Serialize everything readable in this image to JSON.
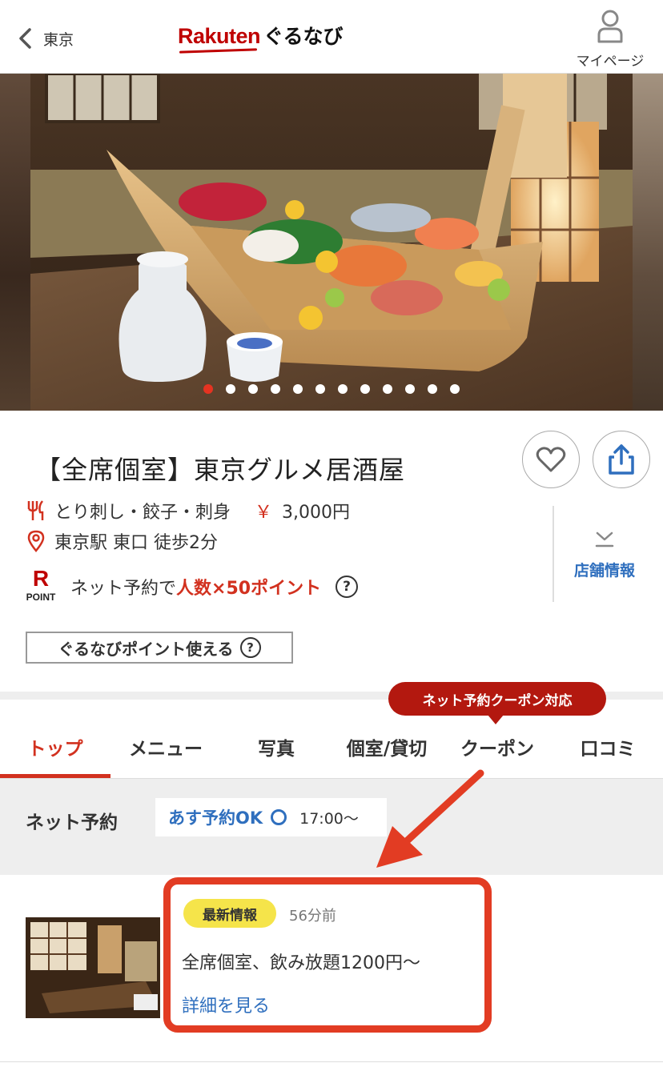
{
  "header": {
    "back_label": "東京",
    "logo_rakuten": "Rakuten",
    "logo_gnavi": "ぐるなび",
    "mypage_label": "マイページ"
  },
  "hero": {
    "slide_count": 12,
    "active_slide": 1
  },
  "shop": {
    "name": "【全席個室】東京グルメ居酒屋",
    "genre": "とり刺し・餃子・刺身",
    "price_mark": "￥",
    "price": "3,000円",
    "access": "東京駅 東口 徒歩2分",
    "store_info_label": "店舗情報",
    "point_r": "R",
    "point_word": "POINT",
    "point_prefix": "ネット予約で",
    "point_highlight": "人数×50ポイント",
    "help_mark": "?",
    "gnavi_point_label": "ぐるなびポイント使える"
  },
  "tabs": {
    "coupon_bubble": "ネット予約クーポン対応",
    "items": [
      {
        "label": "トップ"
      },
      {
        "label": "メニュー"
      },
      {
        "label": "写真"
      },
      {
        "label": "個室/貸切"
      },
      {
        "label": "クーポン"
      },
      {
        "label": "口コミ"
      }
    ],
    "active_index": 0
  },
  "reserve": {
    "label": "ネット予約",
    "ok_label": "あす予約OK",
    "time": "17:00〜"
  },
  "news": {
    "badge": "最新情報",
    "time_ago": "56分前",
    "text": "全席個室、飲み放題1200円〜",
    "link": "詳細を見る"
  },
  "colors": {
    "accent_red": "#d2311f",
    "link_blue": "#2f6fbe",
    "badge_yellow": "#f5e44a",
    "highlight_border": "#e23c23"
  },
  "icons": {
    "back": "chevron-left-icon",
    "user": "user-icon",
    "heart": "heart-icon",
    "share": "share-icon",
    "utensils": "utensils-icon",
    "location": "location-pin-icon",
    "download": "chevron-down-bar-icon",
    "help": "help-circle-icon",
    "arrow": "red-arrow-icon"
  }
}
